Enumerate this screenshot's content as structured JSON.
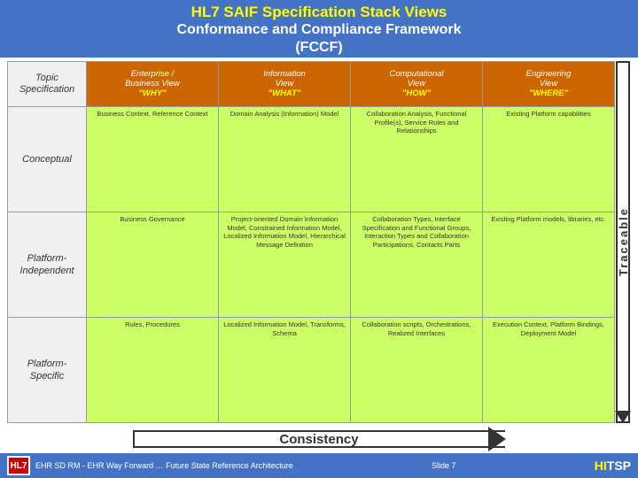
{
  "header": {
    "title1": "HL7 SAIF Specification Stack Views",
    "title2": "Conformance and Compliance Framework",
    "title3": "(FCCF)"
  },
  "leftLabels": {
    "header": "Topic\nSpecification",
    "rows": [
      "Conceptual",
      "Platform-\nIndependent",
      "Platform-\nSpecific"
    ]
  },
  "colHeaders": [
    {
      "viewType": "Enterprise /\nBusiness View",
      "viewLabel": "\"WHY\""
    },
    {
      "viewType": "Information\nView",
      "viewLabel": "\"WHAT\""
    },
    {
      "viewType": "Computational\nView",
      "viewLabel": "\"HOW\""
    },
    {
      "viewType": "Engineering\nView",
      "viewLabel": "\"WHERE\""
    }
  ],
  "gridData": [
    [
      "Business Context, Reference Context",
      "Domain Analysis (Information) Model",
      "Collaboration Analysis, Functional Profile(s), Service Roles and Relationships",
      "Existing Platform capabilities"
    ],
    [
      "Business Governance",
      "Project-oriented Domain Information Model, Constrained Information Model, Localized Information Model, Hierarchical Message Definition",
      "Collaboration Types, Interface Specification and Functional Groups, Interaction Types and Collaboration Participations, Contacts Parts",
      "Existing Platform models, libraries, etc."
    ],
    [
      "Rules, Procedures",
      "Localized Information Model, Transforms, Schema",
      "Collaboration scripts, Orchestrations, Realized Interfaces",
      "Execution Context, Platform Bindings, Deployment Model"
    ]
  ],
  "traceable": {
    "label": "Traceable"
  },
  "consistency": {
    "label": "Consistency"
  },
  "footer": {
    "text": "EHR SD RM - EHR Way Forward …  Future State Reference Architecture",
    "slide": "Slide 7"
  }
}
